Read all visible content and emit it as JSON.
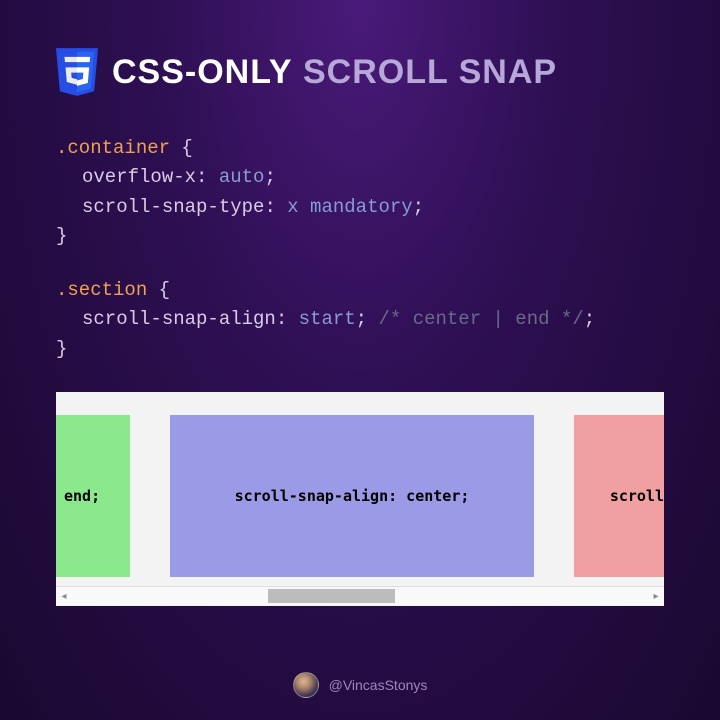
{
  "header": {
    "title_strong": "CSS-ONLY",
    "title_light": " SCROLL SNAP",
    "icon": "css3"
  },
  "code": {
    "block1": {
      "selector": ".container",
      "open": " {",
      "line1_prop": "overflow-x",
      "line1_sep": ": ",
      "line1_val": "auto",
      "line1_end": ";",
      "line2_prop": "scroll-snap-type",
      "line2_sep": ": ",
      "line2_val": "x mandatory",
      "line2_end": ";",
      "close": "}"
    },
    "block2": {
      "selector": ".section",
      "open": " {",
      "line1_prop": "scroll-snap-align",
      "line1_sep": ": ",
      "line1_val": "start",
      "line1_semi": "; ",
      "line1_comment": "/* center | end */",
      "line1_end": ";",
      "close": "}"
    }
  },
  "demo": {
    "box_green": "end;",
    "box_purple": "scroll-snap-align: center;",
    "box_red": "scroll"
  },
  "footer": {
    "handle": "@VincasStonys"
  }
}
